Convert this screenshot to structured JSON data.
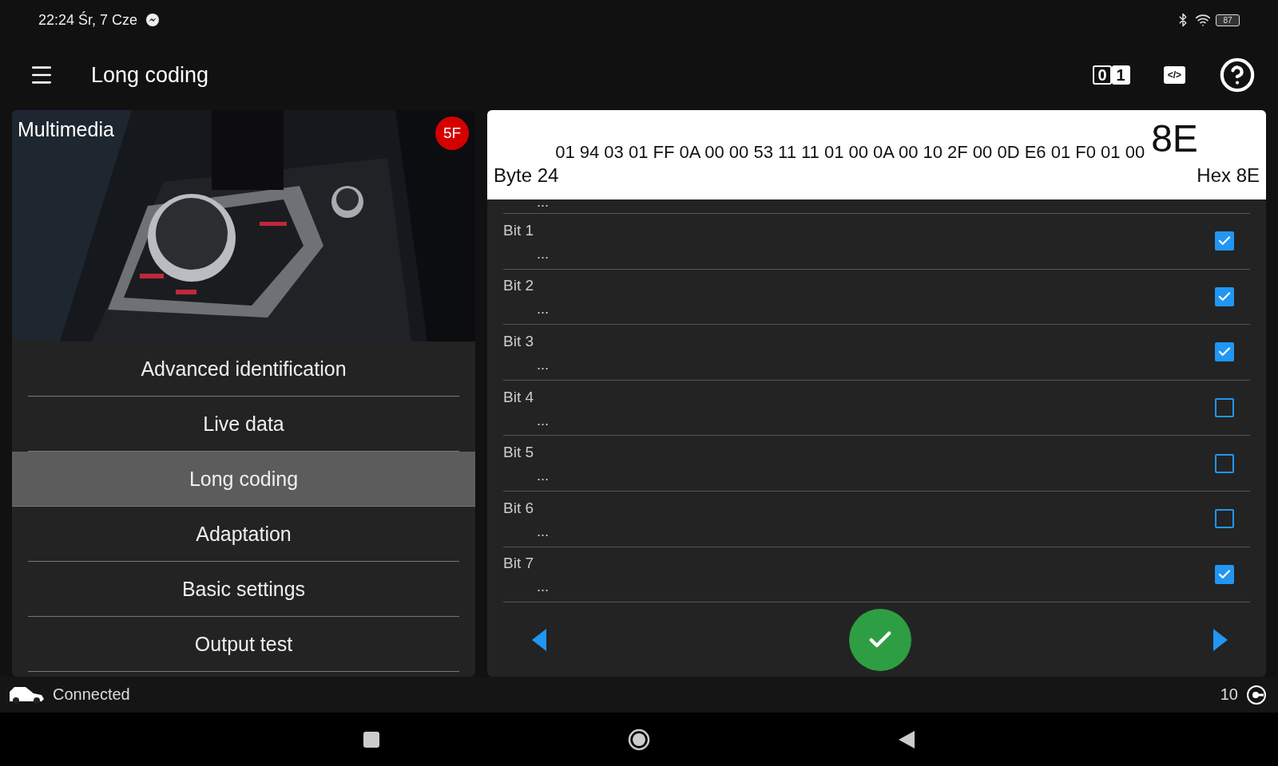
{
  "status_bar": {
    "time": "22:24 Śr, 7 Cze",
    "battery": "87"
  },
  "app_bar": {
    "title": "Long coding",
    "binary_digits": [
      "0",
      "1"
    ],
    "code_label": "</>"
  },
  "module": {
    "title": "Multimedia",
    "badge": "5F"
  },
  "menu": [
    {
      "label": "Advanced identification",
      "selected": false
    },
    {
      "label": "Live data",
      "selected": false
    },
    {
      "label": "Long coding",
      "selected": true
    },
    {
      "label": "Adaptation",
      "selected": false
    },
    {
      "label": "Basic settings",
      "selected": false
    },
    {
      "label": "Output test",
      "selected": false
    }
  ],
  "coding": {
    "bytes": "01 94 03 01 FF 0A 00 00 53 11 11 01 00 0A 00 10 2F 00 0D E6 01 F0 01 00",
    "current": "8E",
    "byte_label": "Byte 24",
    "hex_label": "Hex 8E",
    "partial_value": "...",
    "bits": [
      {
        "label": "Bit 1",
        "value": "...",
        "checked": true
      },
      {
        "label": "Bit 2",
        "value": "...",
        "checked": true
      },
      {
        "label": "Bit 3",
        "value": "...",
        "checked": true
      },
      {
        "label": "Bit 4",
        "value": "...",
        "checked": false
      },
      {
        "label": "Bit 5",
        "value": "...",
        "checked": false
      },
      {
        "label": "Bit 6",
        "value": "...",
        "checked": false
      },
      {
        "label": "Bit 7",
        "value": "...",
        "checked": true
      }
    ]
  },
  "footer": {
    "status": "Connected",
    "count": "10"
  }
}
